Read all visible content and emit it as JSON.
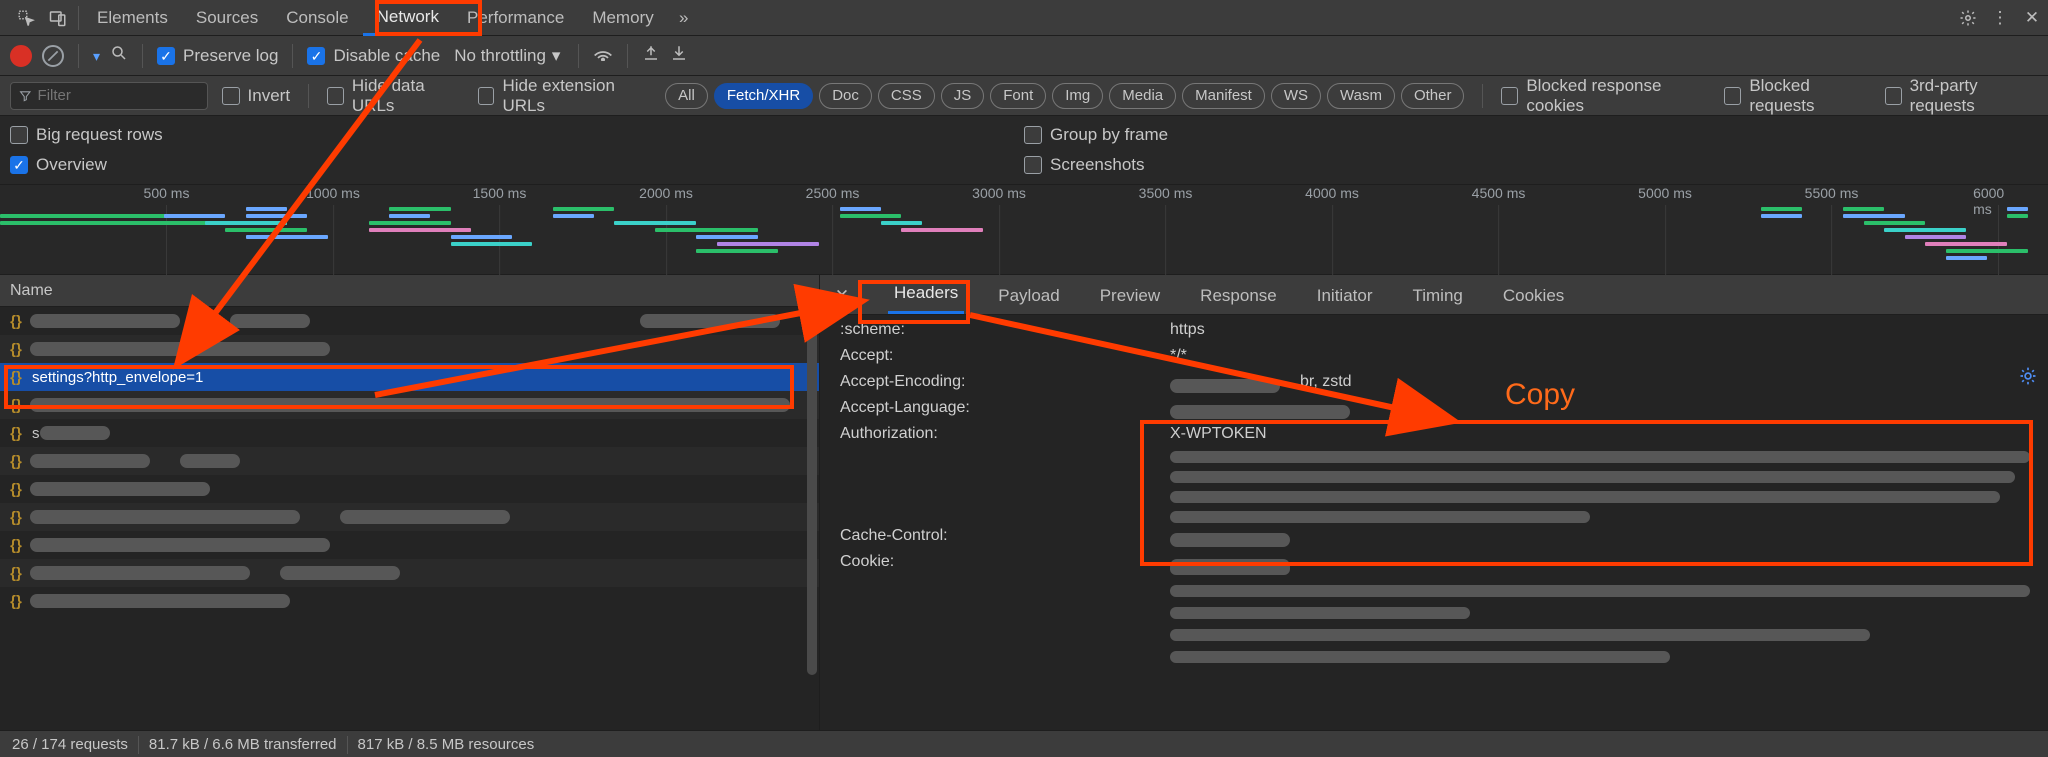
{
  "top_tabs": {
    "items": [
      "Elements",
      "Sources",
      "Console",
      "Network",
      "Performance",
      "Memory"
    ],
    "active": "Network"
  },
  "toolbar": {
    "preserve_log_label": "Preserve log",
    "disable_cache_label": "Disable cache",
    "throttling_label": "No throttling"
  },
  "filterbar": {
    "filter_placeholder": "Filter",
    "invert_label": "Invert",
    "hide_data_urls_label": "Hide data URLs",
    "hide_ext_urls_label": "Hide extension URLs",
    "pills": [
      "All",
      "Fetch/XHR",
      "Doc",
      "CSS",
      "JS",
      "Font",
      "Img",
      "Media",
      "Manifest",
      "WS",
      "Wasm",
      "Other"
    ],
    "active_pill": "Fetch/XHR",
    "blocked_cookies_label": "Blocked response cookies",
    "blocked_requests_label": "Blocked requests",
    "third_party_label": "3rd-party requests"
  },
  "options": {
    "big_rows_label": "Big request rows",
    "overview_label": "Overview",
    "group_by_frame_label": "Group by frame",
    "screenshots_label": "Screenshots"
  },
  "timeline": {
    "ticks": [
      "500 ms",
      "1000 ms",
      "1500 ms",
      "2000 ms",
      "2500 ms",
      "3000 ms",
      "3500 ms",
      "4000 ms",
      "4500 ms",
      "5000 ms",
      "5500 ms",
      "6000 ms"
    ]
  },
  "requests": {
    "name_header": "Name",
    "items": [
      {
        "name": ""
      },
      {
        "name": ""
      },
      {
        "name": "settings?http_envelope=1"
      },
      {
        "name": ""
      },
      {
        "name": "s"
      },
      {
        "name": ""
      },
      {
        "name": ""
      },
      {
        "name": ""
      },
      {
        "name": ""
      },
      {
        "name": ""
      },
      {
        "name": ""
      }
    ],
    "selected_index": 2
  },
  "details": {
    "tabs": [
      "Headers",
      "Payload",
      "Preview",
      "Response",
      "Initiator",
      "Timing",
      "Cookies"
    ],
    "active": "Headers",
    "rows": [
      {
        "k": ":scheme:",
        "v": "https"
      },
      {
        "k": "Accept:",
        "v": "*/*"
      },
      {
        "k": "Accept-Encoding:",
        "v": "br, zstd"
      },
      {
        "k": "Accept-Language:",
        "v": ""
      },
      {
        "k": "Authorization:",
        "v": "X-WPTOKEN"
      },
      {
        "k": "Cache-Control:",
        "v": ""
      },
      {
        "k": "Cookie:",
        "v": ""
      }
    ]
  },
  "annotation": {
    "copy_label": "Copy"
  },
  "status": {
    "requests": "26 / 174 requests",
    "transferred": "81.7 kB / 6.6 MB transferred",
    "resources": "817 kB / 8.5 MB resources"
  }
}
